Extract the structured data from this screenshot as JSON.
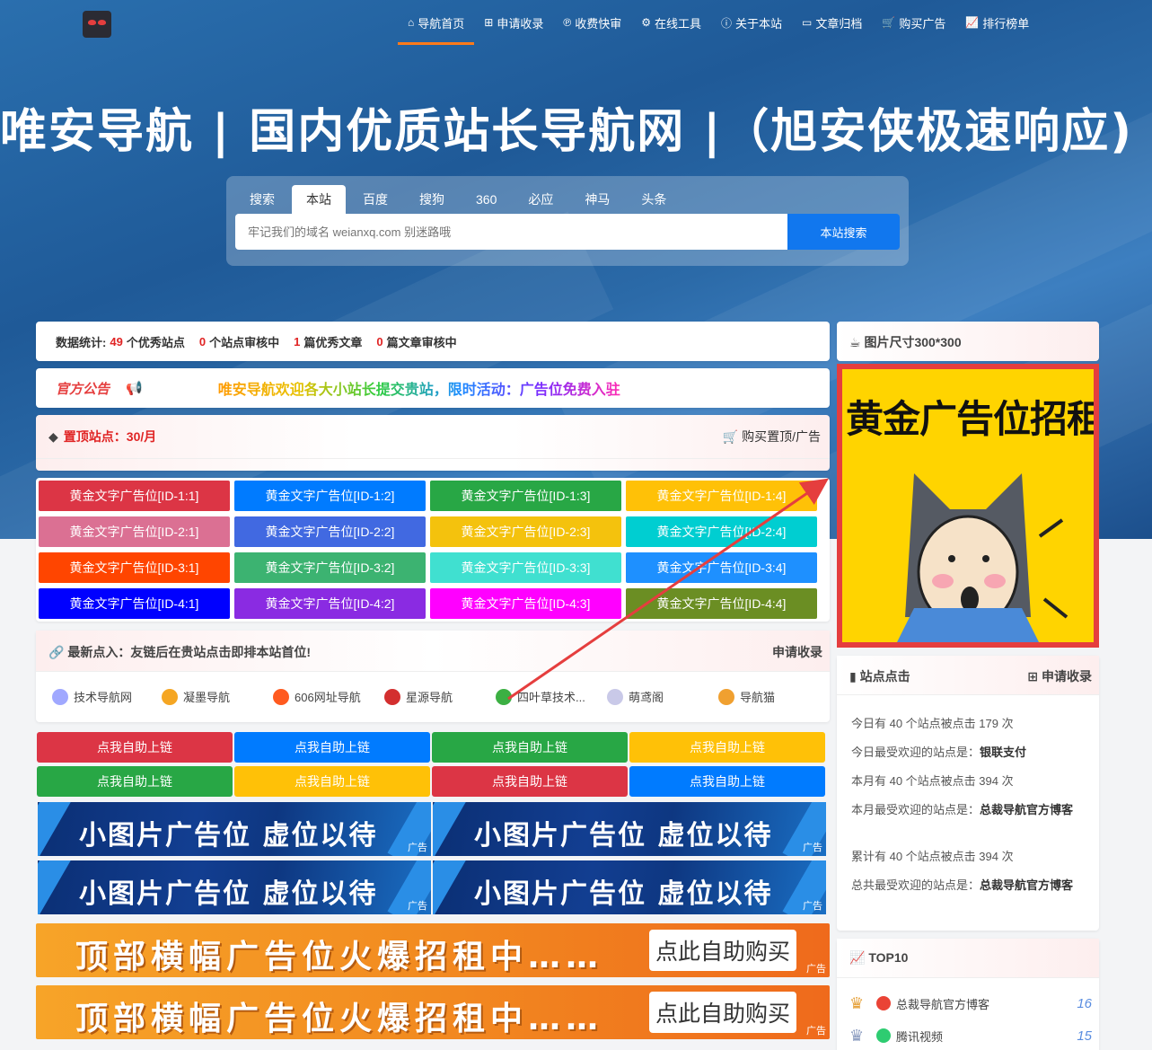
{
  "nav": {
    "items": [
      {
        "icon": "home-icon",
        "glyph": "⌂",
        "label": "导航首页"
      },
      {
        "icon": "plus-square-icon",
        "glyph": "⊞",
        "label": "申请收录"
      },
      {
        "icon": "paypal-icon",
        "glyph": "℗",
        "label": "收费快审"
      },
      {
        "icon": "gears-icon",
        "glyph": "⚙",
        "label": "在线工具"
      },
      {
        "icon": "info-circle-icon",
        "glyph": "ⓘ",
        "label": "关于本站"
      },
      {
        "icon": "folder-icon",
        "glyph": "▭",
        "label": "文章归档"
      },
      {
        "icon": "cart-icon",
        "glyph": "🛒",
        "label": "购买广告"
      },
      {
        "icon": "chart-icon",
        "glyph": "📈",
        "label": "排行榜单"
      }
    ]
  },
  "hero": {
    "title": "唯安导航 | 国内优质站长导航网 |（旭安侠极速响应)"
  },
  "search": {
    "tabs": [
      "搜索",
      "本站",
      "百度",
      "搜狗",
      "360",
      "必应",
      "神马",
      "头条"
    ],
    "active_tab": "本站",
    "placeholder": "牢记我们的域名 weianxq.com 别迷路哦",
    "button": "本站搜索"
  },
  "stats": {
    "prefix": "数据统计:",
    "sites": "49",
    "sites_label": "个优秀站点",
    "pending_sites": "0",
    "pending_sites_label": "个站点审核中",
    "articles": "1",
    "articles_label": "篇优秀文章",
    "pending_articles": "0",
    "pending_articles_label": "篇文章审核中"
  },
  "notice": {
    "label": "官方公告",
    "text": "唯安导航欢迎各大小站长提交贵站，限时活动：广告位免费入驻"
  },
  "pinned": {
    "title": "置顶站点：30/月",
    "buy": "购买置顶/广告"
  },
  "text_ads": [
    {
      "label": "黄金文字广告位[ID-1:1]",
      "color": "#dc3545"
    },
    {
      "label": "黄金文字广告位[ID-1:2]",
      "color": "#007bff"
    },
    {
      "label": "黄金文字广告位[ID-1:3]",
      "color": "#28a745"
    },
    {
      "label": "黄金文字广告位[ID-1:4]",
      "color": "#ffc107"
    },
    {
      "label": "黄金文字广告位[ID-2:1]",
      "color": "#db7093"
    },
    {
      "label": "黄金文字广告位[ID-2:2]",
      "color": "#4169e1"
    },
    {
      "label": "黄金文字广告位[ID-2:3]",
      "color": "#f4c20d"
    },
    {
      "label": "黄金文字广告位[ID-2:4]",
      "color": "#00ced1"
    },
    {
      "label": "黄金文字广告位[ID-3:1]",
      "color": "#ff4500"
    },
    {
      "label": "黄金文字广告位[ID-3:2]",
      "color": "#3cb371"
    },
    {
      "label": "黄金文字广告位[ID-3:3]",
      "color": "#40e0d0"
    },
    {
      "label": "黄金文字广告位[ID-3:4]",
      "color": "#1e90ff"
    },
    {
      "label": "黄金文字广告位[ID-4:1]",
      "color": "#0000ff"
    },
    {
      "label": "黄金文字广告位[ID-4:2]",
      "color": "#8a2be2"
    },
    {
      "label": "黄金文字广告位[ID-4:3]",
      "color": "#ff00ff"
    },
    {
      "label": "黄金文字广告位[ID-4:4]",
      "color": "#6b8e23"
    }
  ],
  "links": {
    "title": "最新点入：友链后在贵站点击即排本站首位!",
    "apply": "申请收录",
    "items": [
      {
        "label": "技术导航网",
        "color": "#a0a8ff"
      },
      {
        "label": "凝墨导航",
        "color": "#f5a623"
      },
      {
        "label": "606网址导航",
        "color": "#ff5a1f"
      },
      {
        "label": "星源导航",
        "color": "#d32f2f"
      },
      {
        "label": "四叶草技术...",
        "color": "#3cb043"
      },
      {
        "label": "萌鸢阁",
        "color": "#c9c9e8"
      },
      {
        "label": "导航猫",
        "color": "#f0a030"
      }
    ]
  },
  "self_ads": [
    {
      "label": "点我自助上链",
      "color": "#dc3545"
    },
    {
      "label": "点我自助上链",
      "color": "#007bff"
    },
    {
      "label": "点我自助上链",
      "color": "#28a745"
    },
    {
      "label": "点我自助上链",
      "color": "#ffc107"
    },
    {
      "label": "点我自助上链",
      "color": "#28a745"
    },
    {
      "label": "点我自助上链",
      "color": "#ffc107"
    },
    {
      "label": "点我自助上链",
      "color": "#dc3545"
    },
    {
      "label": "点我自助上链",
      "color": "#007bff"
    }
  ],
  "img_ads": {
    "text": "小图片广告位 虚位以待",
    "tag": "广告"
  },
  "banners": {
    "text": "顶部横幅广告位火爆招租中……",
    "button": "点此自助购买",
    "tag": "广告"
  },
  "side_ad": {
    "title": "图片尺寸300*300",
    "image_text": "黄金广告位招租中"
  },
  "site_clicks": {
    "title": "站点点击",
    "apply": "申请收录",
    "lines": [
      {
        "a": "今日有 40 个站点被点击 179 次",
        "b": ""
      },
      {
        "a": "今日最受欢迎的站点是：",
        "b": "银联支付"
      },
      {
        "a": "本月有 40 个站点被点击 394 次",
        "b": ""
      },
      {
        "a": "本月最受欢迎的站点是：",
        "b": "总裁导航官方博客"
      },
      {
        "a": "累计有 40 个站点被点击 394 次",
        "b": ""
      },
      {
        "a": "总共最受欢迎的站点是：",
        "b": "总裁导航官方博客"
      }
    ]
  },
  "top10": {
    "title": "TOP10",
    "items": [
      {
        "name": "总裁导航官方博客",
        "count": "16",
        "rank_color": "#e6a23c"
      },
      {
        "name": "腾讯视频",
        "count": "15",
        "rank_color": "#8a9bbf"
      }
    ]
  }
}
